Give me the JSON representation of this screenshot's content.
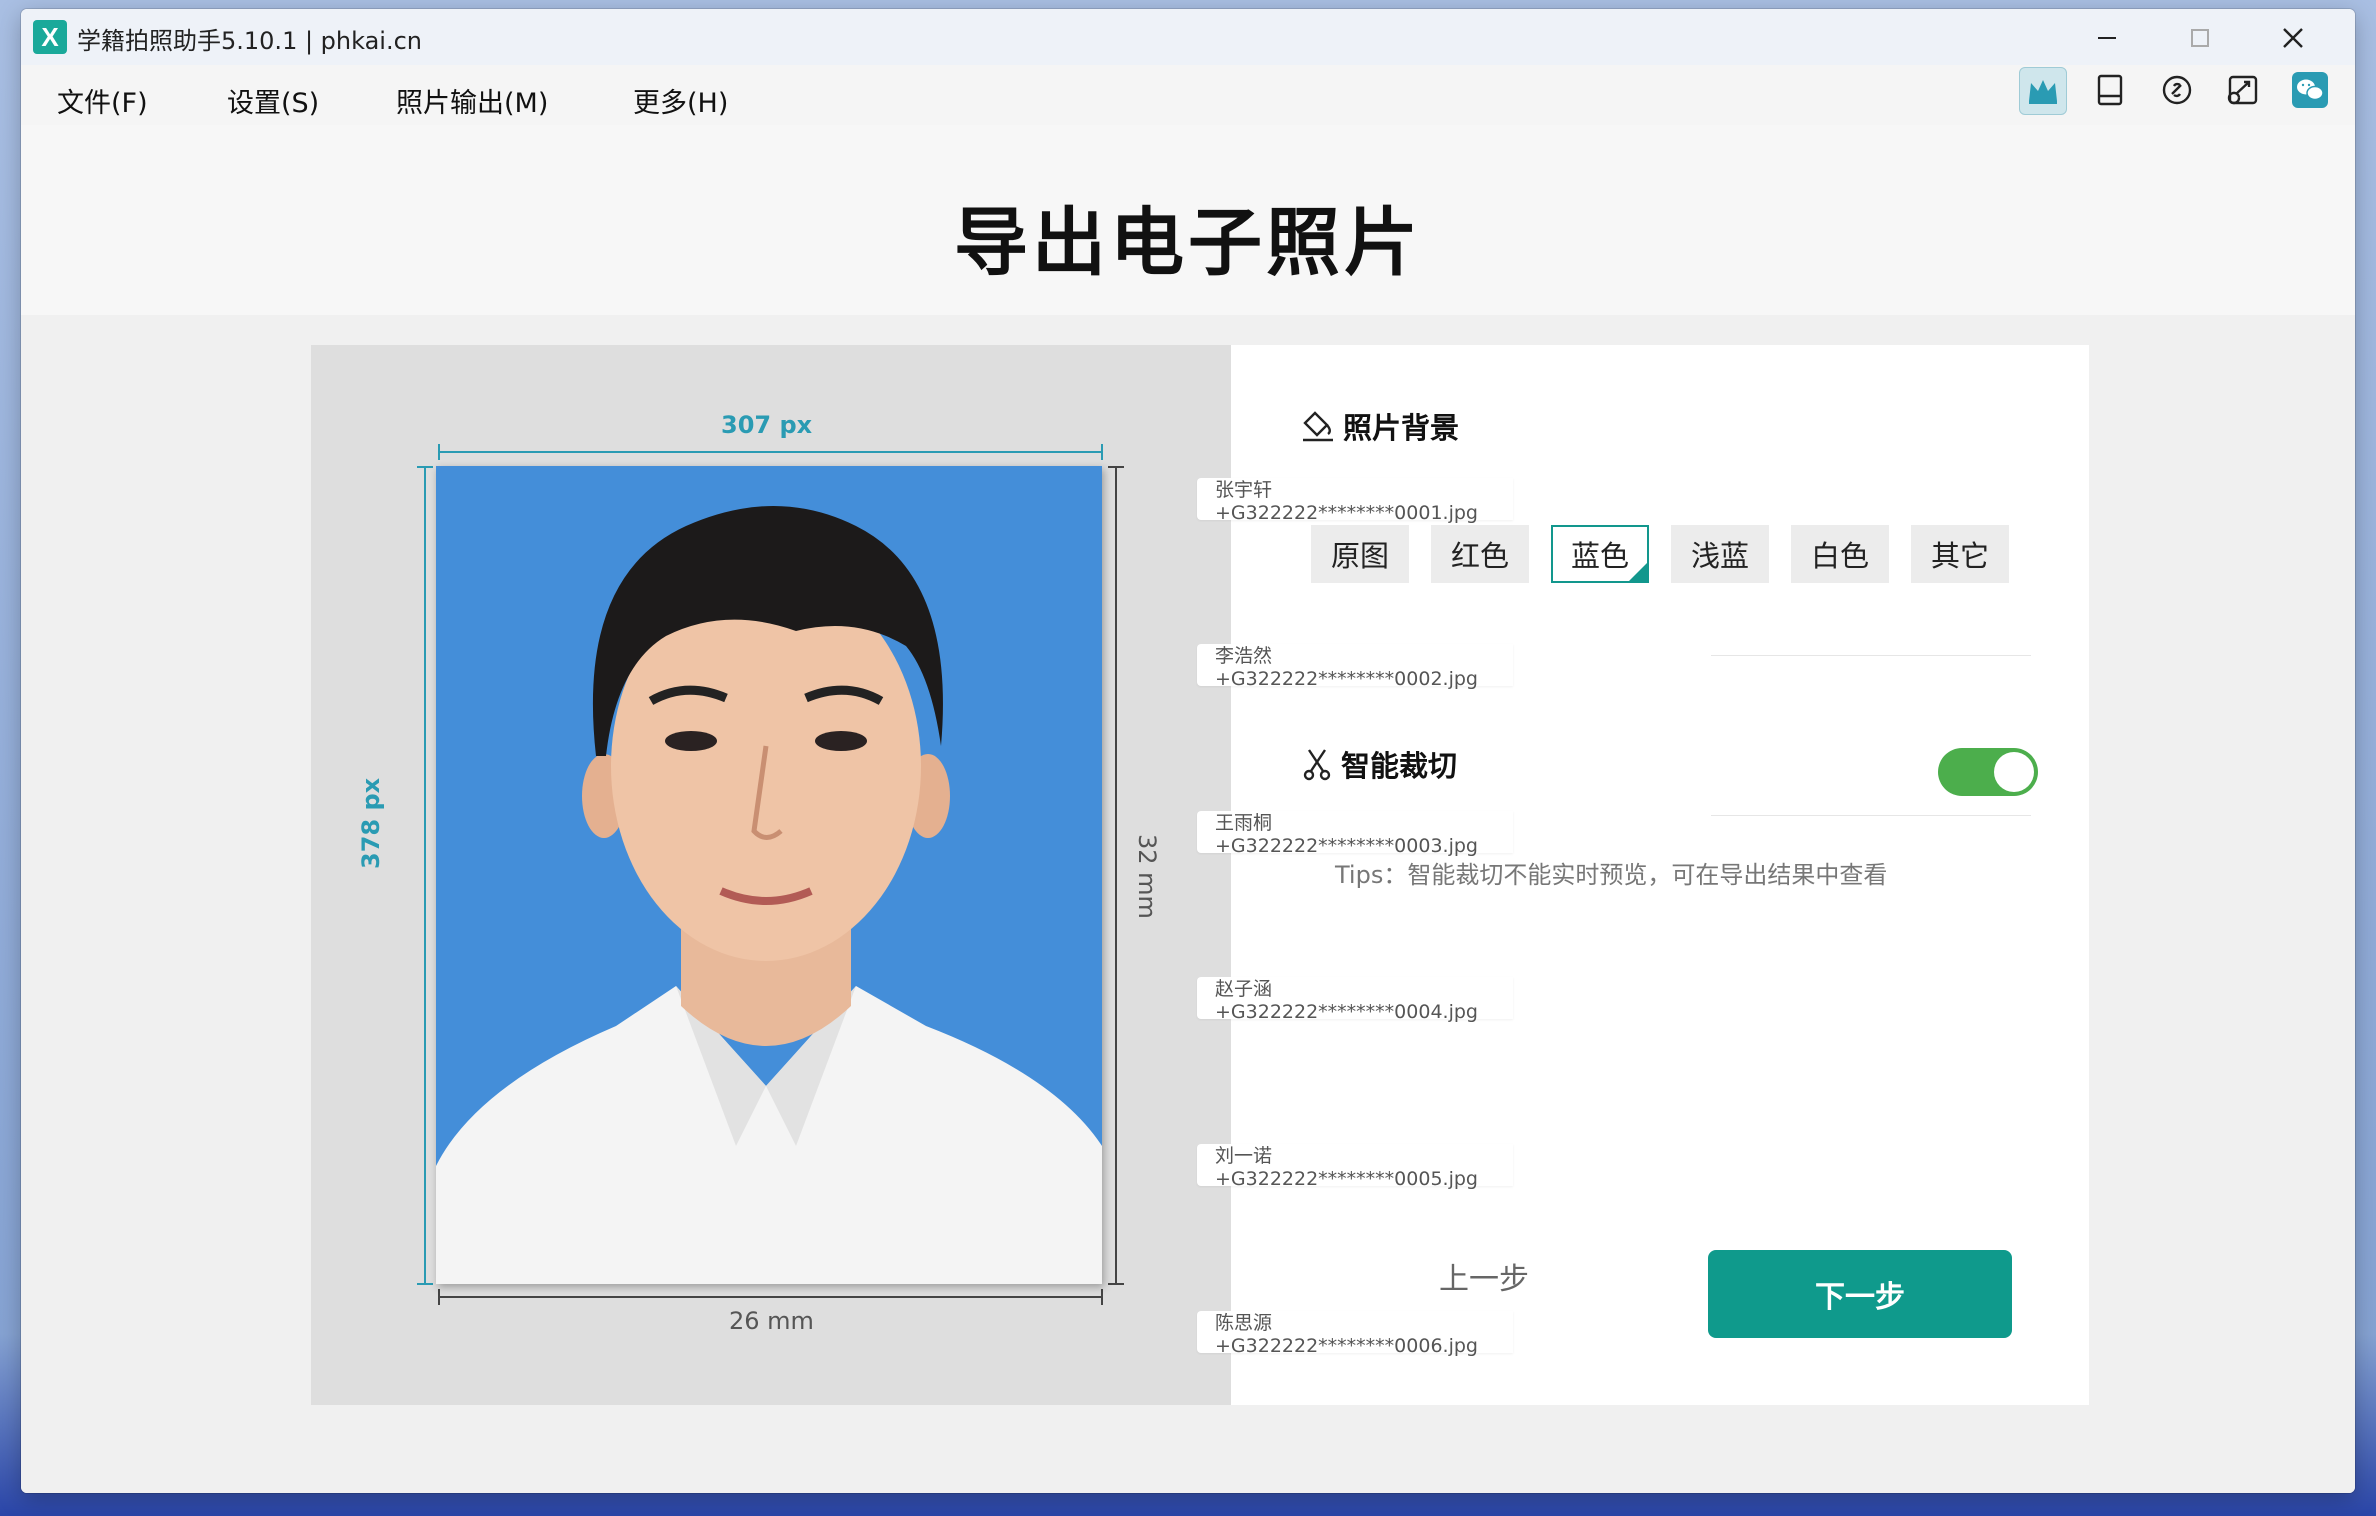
{
  "window": {
    "title": "学籍拍照助手5.10.1 | phkai.cn",
    "app_icon_letter": "X",
    "controls": [
      "minimize-icon",
      "maximize-icon",
      "close-icon"
    ]
  },
  "menu": [
    "文件(F)",
    "设置(S)",
    "照片输出(M)",
    "更多(H)"
  ],
  "toolbar": [
    "crown-icon",
    "tablet-icon",
    "link-icon",
    "sync-icon",
    "wechat-icon"
  ],
  "page": {
    "title": "导出电子照片"
  },
  "preview": {
    "width_px_label": "307 px",
    "height_px_label": "378 px",
    "width_mm_label": "26 mm",
    "height_mm_label": "32 mm",
    "background_color": "#448ed9"
  },
  "background_section": {
    "title": "照片背景",
    "options": [
      "原图",
      "红色",
      "蓝色",
      "浅蓝",
      "白色",
      "其它"
    ],
    "selected": "蓝色"
  },
  "crop_section": {
    "title": "智能裁切",
    "enabled": true,
    "tips": "Tips：智能裁切不能实时预览，可在导出结果中查看"
  },
  "buttons": {
    "prev": "上一步",
    "next": "下一步"
  },
  "files": [
    "张宇轩+G322222********0001.jpg",
    "李浩然+G322222********0002.jpg",
    "王雨桐+G322222********0003.jpg",
    "赵子涵+G322222********0004.jpg",
    "刘一诺+G322222********0005.jpg",
    "陈思源+G322222********0006.jpg"
  ],
  "colors": {
    "accent": "#0f9a8c",
    "toggle_on": "#4cae4c",
    "dimension": "#2a9bb3"
  }
}
